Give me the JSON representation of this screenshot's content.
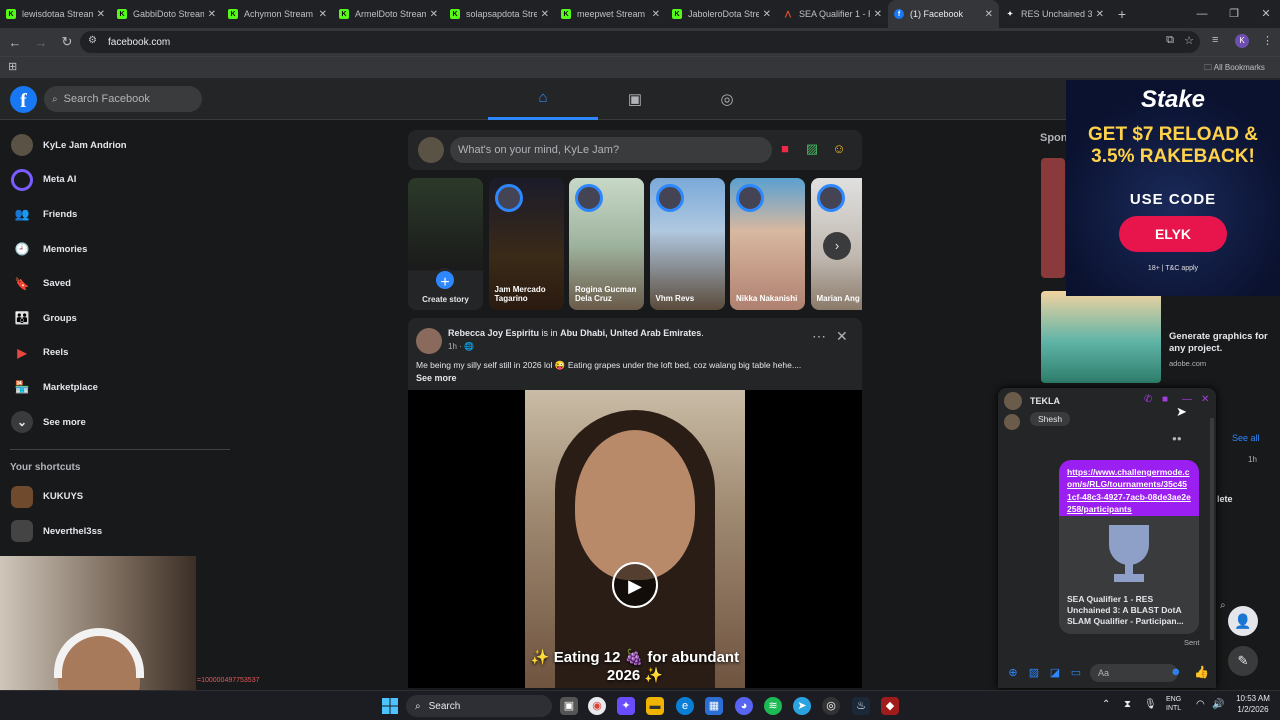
{
  "browser": {
    "tabs": [
      {
        "title": "lewisdotaa Stream",
        "favicon": "kick-icon",
        "active": false
      },
      {
        "title": "GabbiDoto Stream",
        "favicon": "kick-icon",
        "active": false
      },
      {
        "title": "Achymon Stream",
        "favicon": "kick-icon",
        "active": false
      },
      {
        "title": "ArmelDoto Stream",
        "favicon": "kick-icon",
        "active": false
      },
      {
        "title": "solapsapdota Stre",
        "favicon": "kick-icon",
        "active": false
      },
      {
        "title": "meepwet Stream",
        "favicon": "kick-icon",
        "active": false
      },
      {
        "title": "JaboleroDota Stre",
        "favicon": "kick-icon",
        "active": false
      },
      {
        "title": "SEA Qualifier 1 - R",
        "favicon": "challengermode-icon",
        "active": false
      },
      {
        "title": "(1) Facebook",
        "favicon": "facebook-icon",
        "active": true
      },
      {
        "title": "RES Unchained 3",
        "favicon": "res-icon",
        "active": false
      }
    ],
    "url": "facebook.com",
    "all_bookmarks": "All Bookmarks",
    "profile_initial": "K"
  },
  "fb": {
    "search_placeholder": "Search Facebook",
    "sidebar": [
      {
        "label": "KyLe Jam Andrion",
        "icon": "profile-avatar"
      },
      {
        "label": "Meta AI",
        "icon": "meta-ai-icon"
      },
      {
        "label": "Friends",
        "icon": "friends-icon"
      },
      {
        "label": "Memories",
        "icon": "memories-icon"
      },
      {
        "label": "Saved",
        "icon": "saved-icon"
      },
      {
        "label": "Groups",
        "icon": "groups-icon"
      },
      {
        "label": "Reels",
        "icon": "reels-icon"
      },
      {
        "label": "Marketplace",
        "icon": "marketplace-icon"
      },
      {
        "label": "See more",
        "icon": "chevron-down-icon"
      }
    ],
    "shortcuts_title": "Your shortcuts",
    "shortcuts": [
      {
        "label": "KUKUYS"
      },
      {
        "label": "Neverthel3ss"
      }
    ],
    "composer_placeholder": "What's on your mind, KyLe Jam?",
    "stories": [
      {
        "name": "Create story"
      },
      {
        "name": "Jam Mercado Tagarino"
      },
      {
        "name": "Rogina Gucman Dela Cruz"
      },
      {
        "name": "Vhm Revs"
      },
      {
        "name": "Nikka Nakanishi"
      },
      {
        "name": "Marian Ang"
      }
    ],
    "post": {
      "author": "Rebecca Joy Espiritu",
      "is_in": "is in",
      "location": "Abu Dhabi, United Arab Emirates",
      "time": "1h · 🌐",
      "text": "Me being my silly self still in 2026 lol 😜 Eating grapes under the loft bed, coz walang big table hehe....",
      "see_more": "See more",
      "video_caption": "✨ Eating 12 🍇 for abundant 2026 ✨"
    },
    "sponsored": "Spon",
    "stake_ad": {
      "brand": "Stake",
      "headline": "GET $7 RELOAD & 3.5% RAKEBACK!",
      "use_code": "USE CODE",
      "code": "ELYK",
      "terms": "18+ | T&C apply"
    },
    "adobe_ad": {
      "title": "Generate graphics for any project.",
      "site": "adobe.com"
    },
    "see_all": "See all",
    "one_hour": "1h",
    "delete_label": "lete",
    "chat": {
      "name": "TEKLA",
      "prev_msg": "Shesh",
      "link": "https://www.challengermode.com/s/RLG/tournaments/35c451cf-48c3-4927-7acb-08de3ae2e258/participants",
      "card_title": "SEA Qualifier 1 - RES Unchained 3: A BLAST DotA SLAM Qualifier - Participan...",
      "sent": "Sent",
      "input_placeholder": "Aa"
    },
    "profile_id": "=100000497753537"
  },
  "taskbar": {
    "search": "Search",
    "lang": "ENG",
    "lang2": "INTL",
    "time": "10:53 AM",
    "date": "1/2/2026"
  }
}
